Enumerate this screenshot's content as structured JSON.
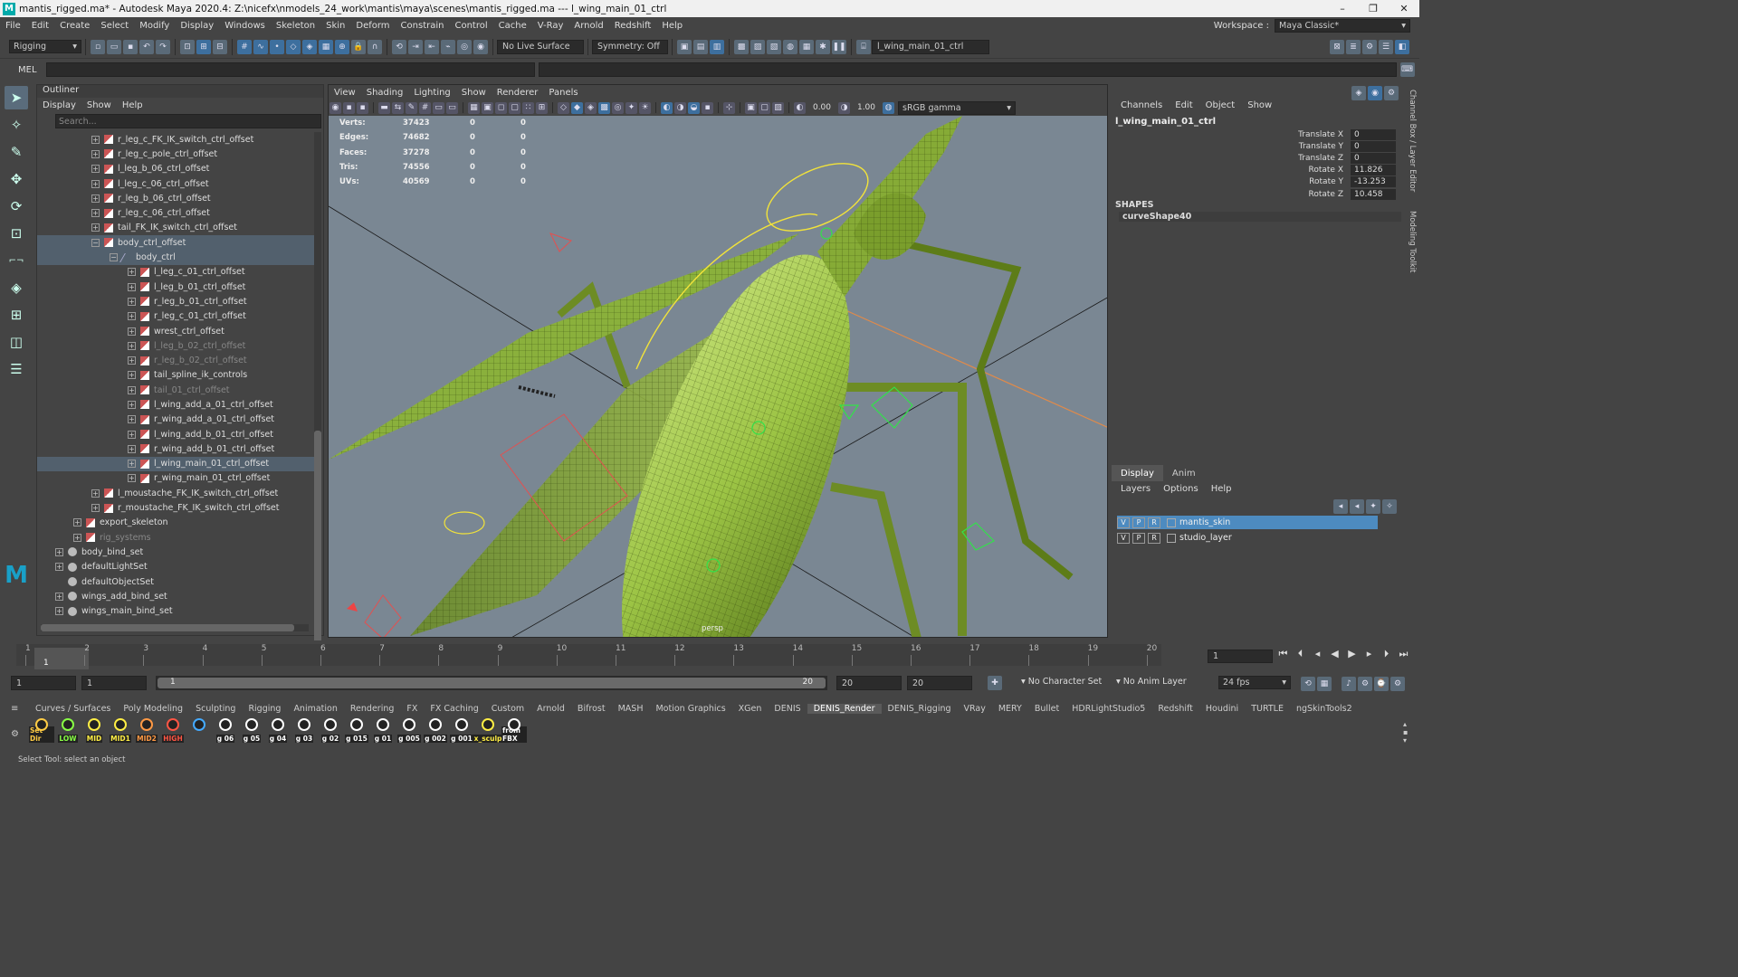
{
  "window": {
    "title": "mantis_rigged.ma* - Autodesk Maya 2020.4: Z:\\nicefx\\nmodels_24_work\\mantis\\maya\\scenes\\mantis_rigged.ma  ---  l_wing_main_01_ctrl",
    "logo": "M",
    "minimize": "–",
    "restore": "❐",
    "close": "✕"
  },
  "menus": [
    "File",
    "Edit",
    "Create",
    "Select",
    "Modify",
    "Display",
    "Windows",
    "Skeleton",
    "Skin",
    "Deform",
    "Constrain",
    "Control",
    "Cache",
    "V-Ray",
    "Arnold",
    "Redshift",
    "Help"
  ],
  "workspace": {
    "label": "Workspace :",
    "value": "Maya Classic*"
  },
  "statusline": {
    "menuset": "Rigging",
    "live_surface": "No Live Surface",
    "symmetry": "Symmetry: Off",
    "selection_field": "l_wing_main_01_ctrl"
  },
  "mel_label": "MEL",
  "outliner": {
    "title": "Outliner",
    "menu": [
      "Display",
      "Show",
      "Help"
    ],
    "search_placeholder": "Search...",
    "rows": [
      {
        "label": "r_leg_c_FK_IK_switch_ctrl_offset",
        "indent": 2,
        "type": "xf",
        "dim": false,
        "sel": false
      },
      {
        "label": "r_leg_c_pole_ctrl_offset",
        "indent": 2,
        "type": "xf",
        "dim": false,
        "sel": false
      },
      {
        "label": "l_leg_b_06_ctrl_offset",
        "indent": 2,
        "type": "xf",
        "dim": false,
        "sel": false
      },
      {
        "label": "l_leg_c_06_ctrl_offset",
        "indent": 2,
        "type": "xf",
        "dim": false,
        "sel": false
      },
      {
        "label": "r_leg_b_06_ctrl_offset",
        "indent": 2,
        "type": "xf",
        "dim": false,
        "sel": false
      },
      {
        "label": "r_leg_c_06_ctrl_offset",
        "indent": 2,
        "type": "xf",
        "dim": false,
        "sel": false
      },
      {
        "label": "tail_FK_IK_switch_ctrl_offset",
        "indent": 2,
        "type": "xf",
        "dim": false,
        "sel": false
      },
      {
        "label": "body_ctrl_offset",
        "indent": 2,
        "type": "xf",
        "dim": false,
        "sel": true,
        "open": true
      },
      {
        "label": "body_ctrl",
        "indent": 3,
        "type": "curve",
        "dim": false,
        "sel": true,
        "open": true
      },
      {
        "label": "l_leg_c_01_ctrl_offset",
        "indent": 4,
        "type": "xf",
        "dim": false,
        "sel": false
      },
      {
        "label": "l_leg_b_01_ctrl_offset",
        "indent": 4,
        "type": "xf",
        "dim": false,
        "sel": false
      },
      {
        "label": "r_leg_b_01_ctrl_offset",
        "indent": 4,
        "type": "xf",
        "dim": false,
        "sel": false
      },
      {
        "label": "r_leg_c_01_ctrl_offset",
        "indent": 4,
        "type": "xf",
        "dim": false,
        "sel": false
      },
      {
        "label": "wrest_ctrl_offset",
        "indent": 4,
        "type": "xf",
        "dim": false,
        "sel": false
      },
      {
        "label": "l_leg_b_02_ctrl_offset",
        "indent": 4,
        "type": "xf",
        "dim": true,
        "sel": false
      },
      {
        "label": "r_leg_b_02_ctrl_offset",
        "indent": 4,
        "type": "xf",
        "dim": true,
        "sel": false
      },
      {
        "label": "tail_spline_ik_controls",
        "indent": 4,
        "type": "xf",
        "dim": false,
        "sel": false
      },
      {
        "label": "tail_01_ctrl_offset",
        "indent": 4,
        "type": "xf",
        "dim": true,
        "sel": false
      },
      {
        "label": "l_wing_add_a_01_ctrl_offset",
        "indent": 4,
        "type": "xf",
        "dim": false,
        "sel": false
      },
      {
        "label": "r_wing_add_a_01_ctrl_offset",
        "indent": 4,
        "type": "xf",
        "dim": false,
        "sel": false
      },
      {
        "label": "l_wing_add_b_01_ctrl_offset",
        "indent": 4,
        "type": "xf",
        "dim": false,
        "sel": false
      },
      {
        "label": "r_wing_add_b_01_ctrl_offset",
        "indent": 4,
        "type": "xf",
        "dim": false,
        "sel": false
      },
      {
        "label": "l_wing_main_01_ctrl_offset",
        "indent": 4,
        "type": "xf",
        "dim": false,
        "sel": true
      },
      {
        "label": "r_wing_main_01_ctrl_offset",
        "indent": 4,
        "type": "xf",
        "dim": false,
        "sel": false
      },
      {
        "label": "l_moustache_FK_IK_switch_ctrl_offset",
        "indent": 2,
        "type": "xf",
        "dim": false,
        "sel": false
      },
      {
        "label": "r_moustache_FK_IK_switch_ctrl_offset",
        "indent": 2,
        "type": "xf",
        "dim": false,
        "sel": false
      },
      {
        "label": "export_skeleton",
        "indent": 1,
        "type": "xf",
        "dim": false,
        "sel": false
      },
      {
        "label": "rig_systems",
        "indent": 1,
        "type": "xf",
        "dim": true,
        "sel": false
      },
      {
        "label": "body_bind_set",
        "indent": 0,
        "type": "set",
        "dim": false,
        "sel": false
      },
      {
        "label": "defaultLightSet",
        "indent": 0,
        "type": "set",
        "dim": false,
        "sel": false
      },
      {
        "label": "defaultObjectSet",
        "indent": 0,
        "type": "set",
        "dim": false,
        "sel": false,
        "noexp": true
      },
      {
        "label": "wings_add_bind_set",
        "indent": 0,
        "type": "set",
        "dim": false,
        "sel": false
      },
      {
        "label": "wings_main_bind_set",
        "indent": 0,
        "type": "set",
        "dim": false,
        "sel": false
      }
    ]
  },
  "viewport": {
    "menu": [
      "View",
      "Shading",
      "Lighting",
      "Show",
      "Renderer",
      "Panels"
    ],
    "exposure": "0.00",
    "gamma": "1.00",
    "colorspace": "sRGB gamma",
    "camera": "persp",
    "hud": [
      {
        "name": "Verts:",
        "a": "37423",
        "b": "0",
        "c": "0"
      },
      {
        "name": "Edges:",
        "a": "74682",
        "b": "0",
        "c": "0"
      },
      {
        "name": "Faces:",
        "a": "37278",
        "b": "0",
        "c": "0"
      },
      {
        "name": "Tris:",
        "a": "74556",
        "b": "0",
        "c": "0"
      },
      {
        "name": "UVs:",
        "a": "40569",
        "b": "0",
        "c": "0"
      }
    ]
  },
  "channelbox": {
    "menu": [
      "Channels",
      "Edit",
      "Object",
      "Show"
    ],
    "object": "l_wing_main_01_ctrl",
    "attrs": [
      {
        "name": "Translate X",
        "value": "0"
      },
      {
        "name": "Translate Y",
        "value": "0"
      },
      {
        "name": "Translate Z",
        "value": "0"
      },
      {
        "name": "Rotate X",
        "value": "11.826"
      },
      {
        "name": "Rotate Y",
        "value": "-13.253"
      },
      {
        "name": "Rotate Z",
        "value": "10.458"
      }
    ],
    "shapes_label": "SHAPES",
    "shape_name": "curveShape40"
  },
  "layer_editor": {
    "tabs": [
      "Display",
      "Anim"
    ],
    "menu": [
      "Layers",
      "Options",
      "Help"
    ],
    "layers": [
      {
        "v": "V",
        "p": "P",
        "r": "R",
        "name": "mantis_skin",
        "sel": true
      },
      {
        "v": "V",
        "p": "P",
        "r": "R",
        "name": "studio_layer",
        "sel": false
      }
    ]
  },
  "side_tabs": [
    "Channel Box / Layer Editor",
    "Modeling Toolkit"
  ],
  "timeline": {
    "ticks": [
      "1",
      "2",
      "3",
      "4",
      "5",
      "6",
      "7",
      "8",
      "9",
      "10",
      "11",
      "12",
      "13",
      "14",
      "15",
      "16",
      "17",
      "18",
      "19",
      "20"
    ],
    "current_frame": "1",
    "current_field": "1"
  },
  "range": {
    "start": "1",
    "start2": "1",
    "slider_start": "1",
    "slider_end": "20",
    "end": "20",
    "end2": "20",
    "character_set": "No Character Set",
    "anim_layer": "No Anim Layer",
    "fps": "24 fps"
  },
  "shelf_tabs": [
    "Curves / Surfaces",
    "Poly Modeling",
    "Sculpting",
    "Rigging",
    "Animation",
    "Rendering",
    "FX",
    "FX Caching",
    "Custom",
    "Arnold",
    "Bifrost",
    "MASH",
    "Motion Graphics",
    "XGen",
    "DENIS",
    "DENIS_Render",
    "DENIS_Rigging",
    "VRay",
    "MERY",
    "Bullet",
    "HDRLightStudio5",
    "Redshift",
    "Houdini",
    "TURTLE",
    "ngSkinTools2"
  ],
  "shelf_active": "DENIS_Render",
  "shelf_icons": [
    {
      "label": "Set Dir",
      "color": "#ffcc44"
    },
    {
      "label": "LOW",
      "color": "#88ff44"
    },
    {
      "label": "MID",
      "color": "#ffee44"
    },
    {
      "label": "MID1",
      "color": "#ffee44"
    },
    {
      "label": "MID2",
      "color": "#ff9944"
    },
    {
      "label": "HIGH",
      "color": "#ff5544"
    },
    {
      "label": "",
      "color": "#44aaff"
    },
    {
      "label": "g 06",
      "color": "#ffffff"
    },
    {
      "label": "g 05",
      "color": "#ffffff"
    },
    {
      "label": "g 04",
      "color": "#ffffff"
    },
    {
      "label": "g 03",
      "color": "#ffffff"
    },
    {
      "label": "g 02",
      "color": "#ffffff"
    },
    {
      "label": "g 015",
      "color": "#ffffff"
    },
    {
      "label": "g 01",
      "color": "#ffffff"
    },
    {
      "label": "g 005",
      "color": "#ffffff"
    },
    {
      "label": "g 002",
      "color": "#ffffff"
    },
    {
      "label": "g 001",
      "color": "#ffffff"
    },
    {
      "label": "x_sculp",
      "color": "#ffee44"
    },
    {
      "label": "from FBX",
      "color": "#ffffff"
    }
  ],
  "help_line": "Select Tool: select an object"
}
